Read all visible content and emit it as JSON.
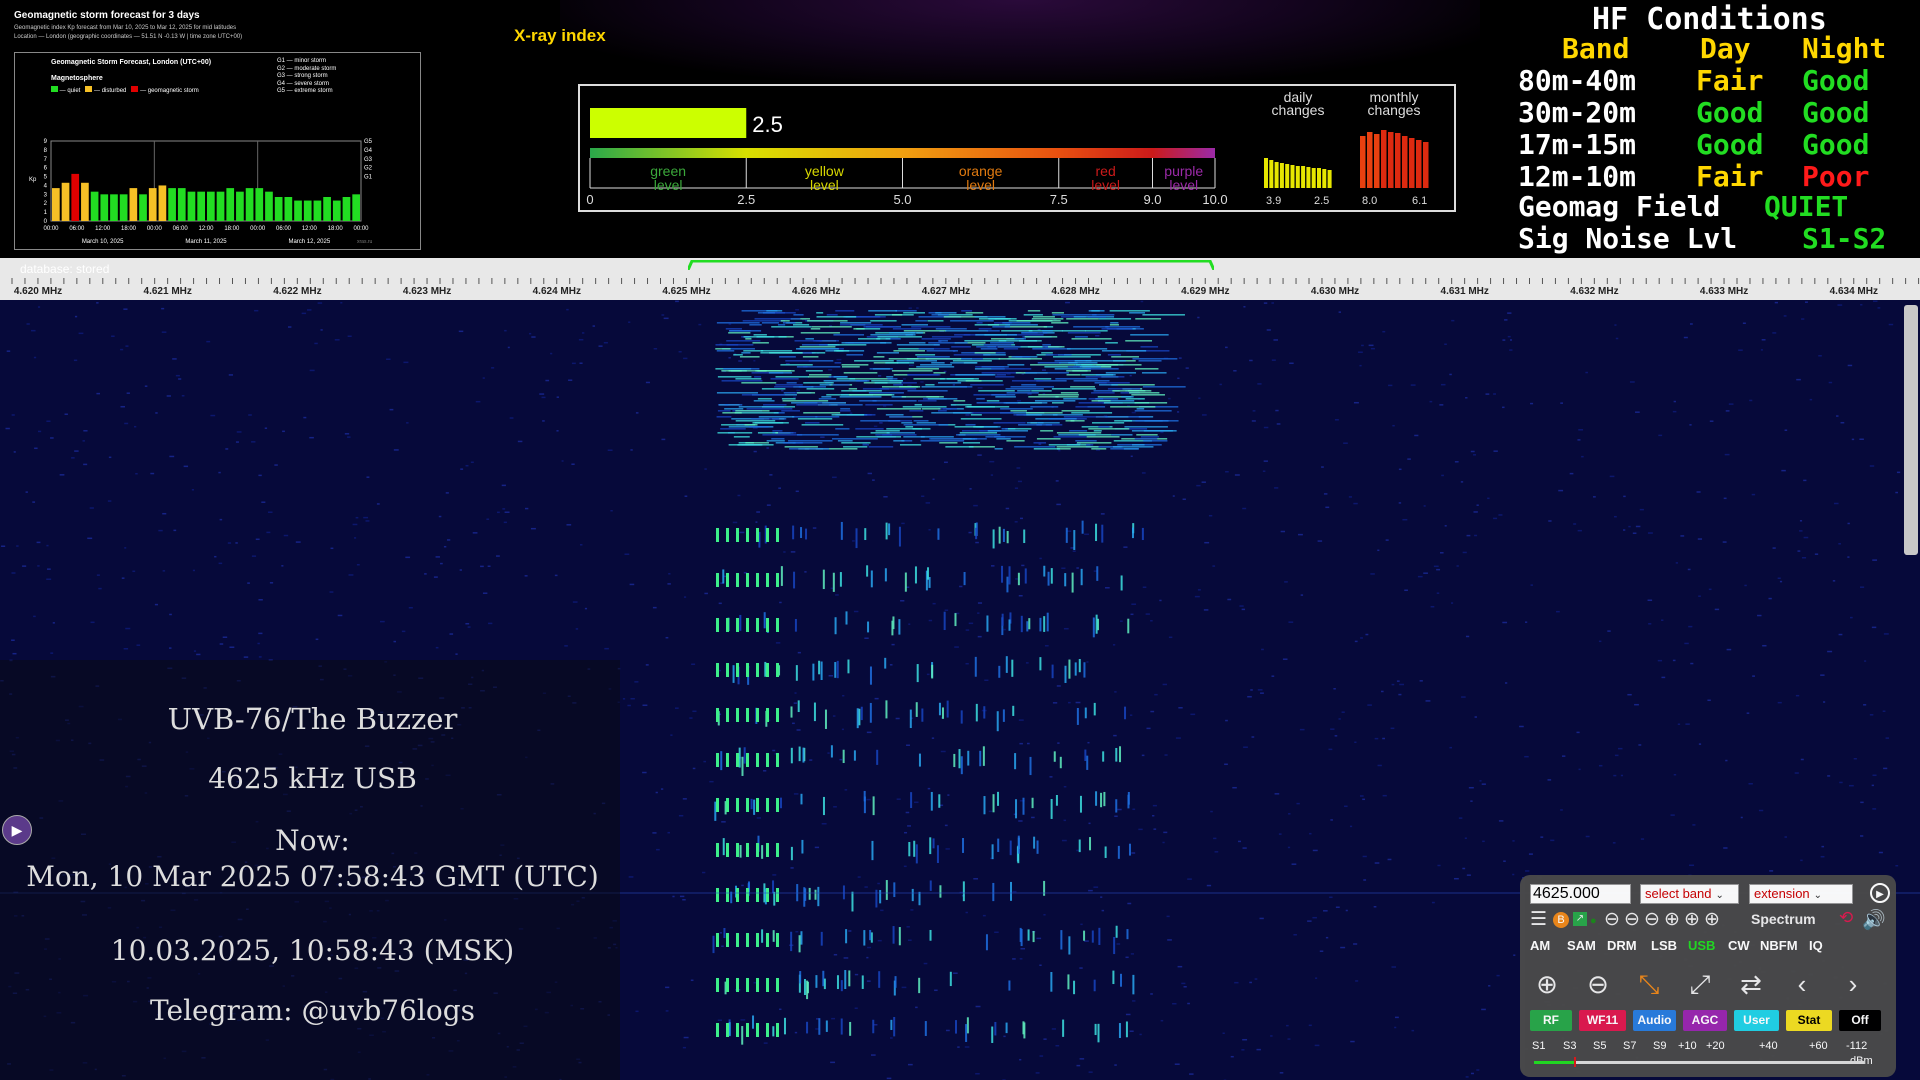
{
  "geomag": {
    "title": "Geomagnetic storm forecast for 3 days",
    "sub1": "Geomagnetic index Kp forecast from Mar 10, 2025 to Mar 12, 2025 for mid latitudes",
    "sub2": "Location — London (geographic coordinates — 51.51 N -0.13 W | time zone UTC+00)",
    "chart_title": "Geomagnetic Storm Forecast, London (UTC+00)",
    "magnetosphere": "Magnetosphere",
    "legend": [
      "— quiet",
      "— disturbed",
      "— geomagnetic storm"
    ],
    "g_levels": [
      "G1 — minor storm",
      "G2 — moderate storm",
      "G3 — strong storm",
      "G4 — severe storm",
      "G5 — extreme storm"
    ],
    "ylabel": "Kp",
    "yticks": [
      "0",
      "1",
      "2",
      "3",
      "4",
      "5",
      "6",
      "7",
      "8",
      "9"
    ],
    "gticks": [
      "G1",
      "G2",
      "G3",
      "G4",
      "G5"
    ],
    "xticks": [
      "00:00",
      "06:00",
      "12:00",
      "18:00",
      "00:00",
      "06:00",
      "12:00",
      "18:00",
      "00:00",
      "06:00",
      "12:00",
      "18:00",
      "00:00"
    ],
    "dates": [
      "March 10, 2025",
      "March 11, 2025",
      "March 12, 2025"
    ],
    "credit": "xras.ru",
    "chart_data": {
      "type": "bar",
      "ylabel": "Kp",
      "ylim": [
        0,
        9
      ],
      "values": [
        3.7,
        4.3,
        5.3,
        4.3,
        3.3,
        3.0,
        3.0,
        3.0,
        3.7,
        3.0,
        3.7,
        4.0,
        3.7,
        3.7,
        3.3,
        3.3,
        3.3,
        3.3,
        3.7,
        3.3,
        3.7,
        3.7,
        3.3,
        2.7,
        2.7,
        2.3,
        2.3,
        2.3,
        2.7,
        2.3,
        2.7,
        3.0
      ],
      "colors": [
        "#f6c026",
        "#f6c026",
        "#e00000",
        "#f6c026",
        "#22dd22",
        "#22dd22",
        "#22dd22",
        "#22dd22",
        "#f6c026",
        "#22dd22",
        "#f6c026",
        "#f6c026",
        "#22dd22",
        "#22dd22",
        "#22dd22",
        "#22dd22",
        "#22dd22",
        "#22dd22",
        "#22dd22",
        "#22dd22",
        "#22dd22",
        "#22dd22",
        "#22dd22",
        "#22dd22",
        "#22dd22",
        "#22dd22",
        "#22dd22",
        "#22dd22",
        "#22dd22",
        "#22dd22",
        "#22dd22",
        "#22dd22"
      ]
    }
  },
  "xray": {
    "title": "X-ray index",
    "value": "2.5",
    "value_num": 2.5,
    "levels": [
      {
        "label1": "green",
        "label2": "level",
        "color": "#3ba83b"
      },
      {
        "label1": "yellow",
        "label2": "level",
        "color": "#d8d800"
      },
      {
        "label1": "orange",
        "label2": "level",
        "color": "#e07a10"
      },
      {
        "label1": "red",
        "label2": "level",
        "color": "#cc1a1a"
      },
      {
        "label1": "purple",
        "label2": "level",
        "color": "#9b2aa8"
      }
    ],
    "ticks": [
      "0",
      "2.5",
      "5.0",
      "7.5",
      "9.0",
      "10.0"
    ],
    "daily_label": [
      "daily",
      "changes"
    ],
    "monthly_label": [
      "monthly",
      "changes"
    ],
    "daily_ticks": [
      "3.9",
      "2.5"
    ],
    "monthly_ticks": [
      "8.0",
      "6.1"
    ]
  },
  "hf": {
    "title": "HF Conditions",
    "header": {
      "band": "Band",
      "day": "Day",
      "night": "Night"
    },
    "rows": [
      {
        "band": "80m-40m",
        "day": "Fair",
        "night": "Good",
        "day_color": "#ffd700",
        "night_color": "#22dd22"
      },
      {
        "band": "30m-20m",
        "day": "Good",
        "night": "Good",
        "day_color": "#22dd22",
        "night_color": "#22dd22"
      },
      {
        "band": "17m-15m",
        "day": "Good",
        "night": "Good",
        "day_color": "#22dd22",
        "night_color": "#22dd22"
      },
      {
        "band": "12m-10m",
        "day": "Fair",
        "night": "Poor",
        "day_color": "#ffd700",
        "night_color": "#ff1a1a"
      }
    ],
    "geomag_label": "Geomag Field",
    "geomag_value": "QUIET",
    "noise_label": "Sig Noise Lvl",
    "noise_value": "S1-S2"
  },
  "scale": {
    "database": "database: stored",
    "labels": [
      "4.620 MHz",
      "4.621 MHz",
      "4.622 MHz",
      "4.623 MHz",
      "4.624 MHz",
      "4.625 MHz",
      "4.626 MHz",
      "4.627 MHz",
      "4.628 MHz",
      "4.629 MHz",
      "4.630 MHz",
      "4.631 MHz",
      "4.632 MHz",
      "4.633 MHz",
      "4.634 MHz"
    ]
  },
  "overlay": {
    "station": "UVB-76/The Buzzer",
    "freq": "4625 kHz USB",
    "now": "Now:",
    "utc": "Mon, 10 Mar 2025 07:58:43 GMT (UTC)",
    "msk": "10.03.2025, 10:58:43 (MSK)",
    "telegram": "Telegram: @uvb76logs"
  },
  "controls": {
    "frequency": "4625.000",
    "band_select": "select band",
    "extension_select": "extension",
    "spectrum": "Spectrum",
    "modes": [
      "AM",
      "SAM",
      "DRM",
      "LSB",
      "USB",
      "CW",
      "NBFM",
      "IQ"
    ],
    "active_mode": "USB",
    "tabs": [
      {
        "label": "RF",
        "bg": "#2aa84a",
        "fg": "#ffffff"
      },
      {
        "label": "WF11",
        "bg": "#e01a4f",
        "fg": "#ffffff"
      },
      {
        "label": "Audio",
        "bg": "#2a7ee0",
        "fg": "#ffffff"
      },
      {
        "label": "AGC",
        "bg": "#9b27b0",
        "fg": "#ffffff"
      },
      {
        "label": "User",
        "bg": "#21d4e8",
        "fg": "#ffffff"
      },
      {
        "label": "Stat",
        "bg": "#f4e022",
        "fg": "#000000"
      },
      {
        "label": "Off",
        "bg": "#000000",
        "fg": "#ffffff"
      }
    ],
    "smeter": [
      "S1",
      "S3",
      "S5",
      "S7",
      "S9",
      "+10",
      "+20",
      "+40",
      "+60",
      "-112"
    ],
    "smeter_unit": "dBm"
  }
}
